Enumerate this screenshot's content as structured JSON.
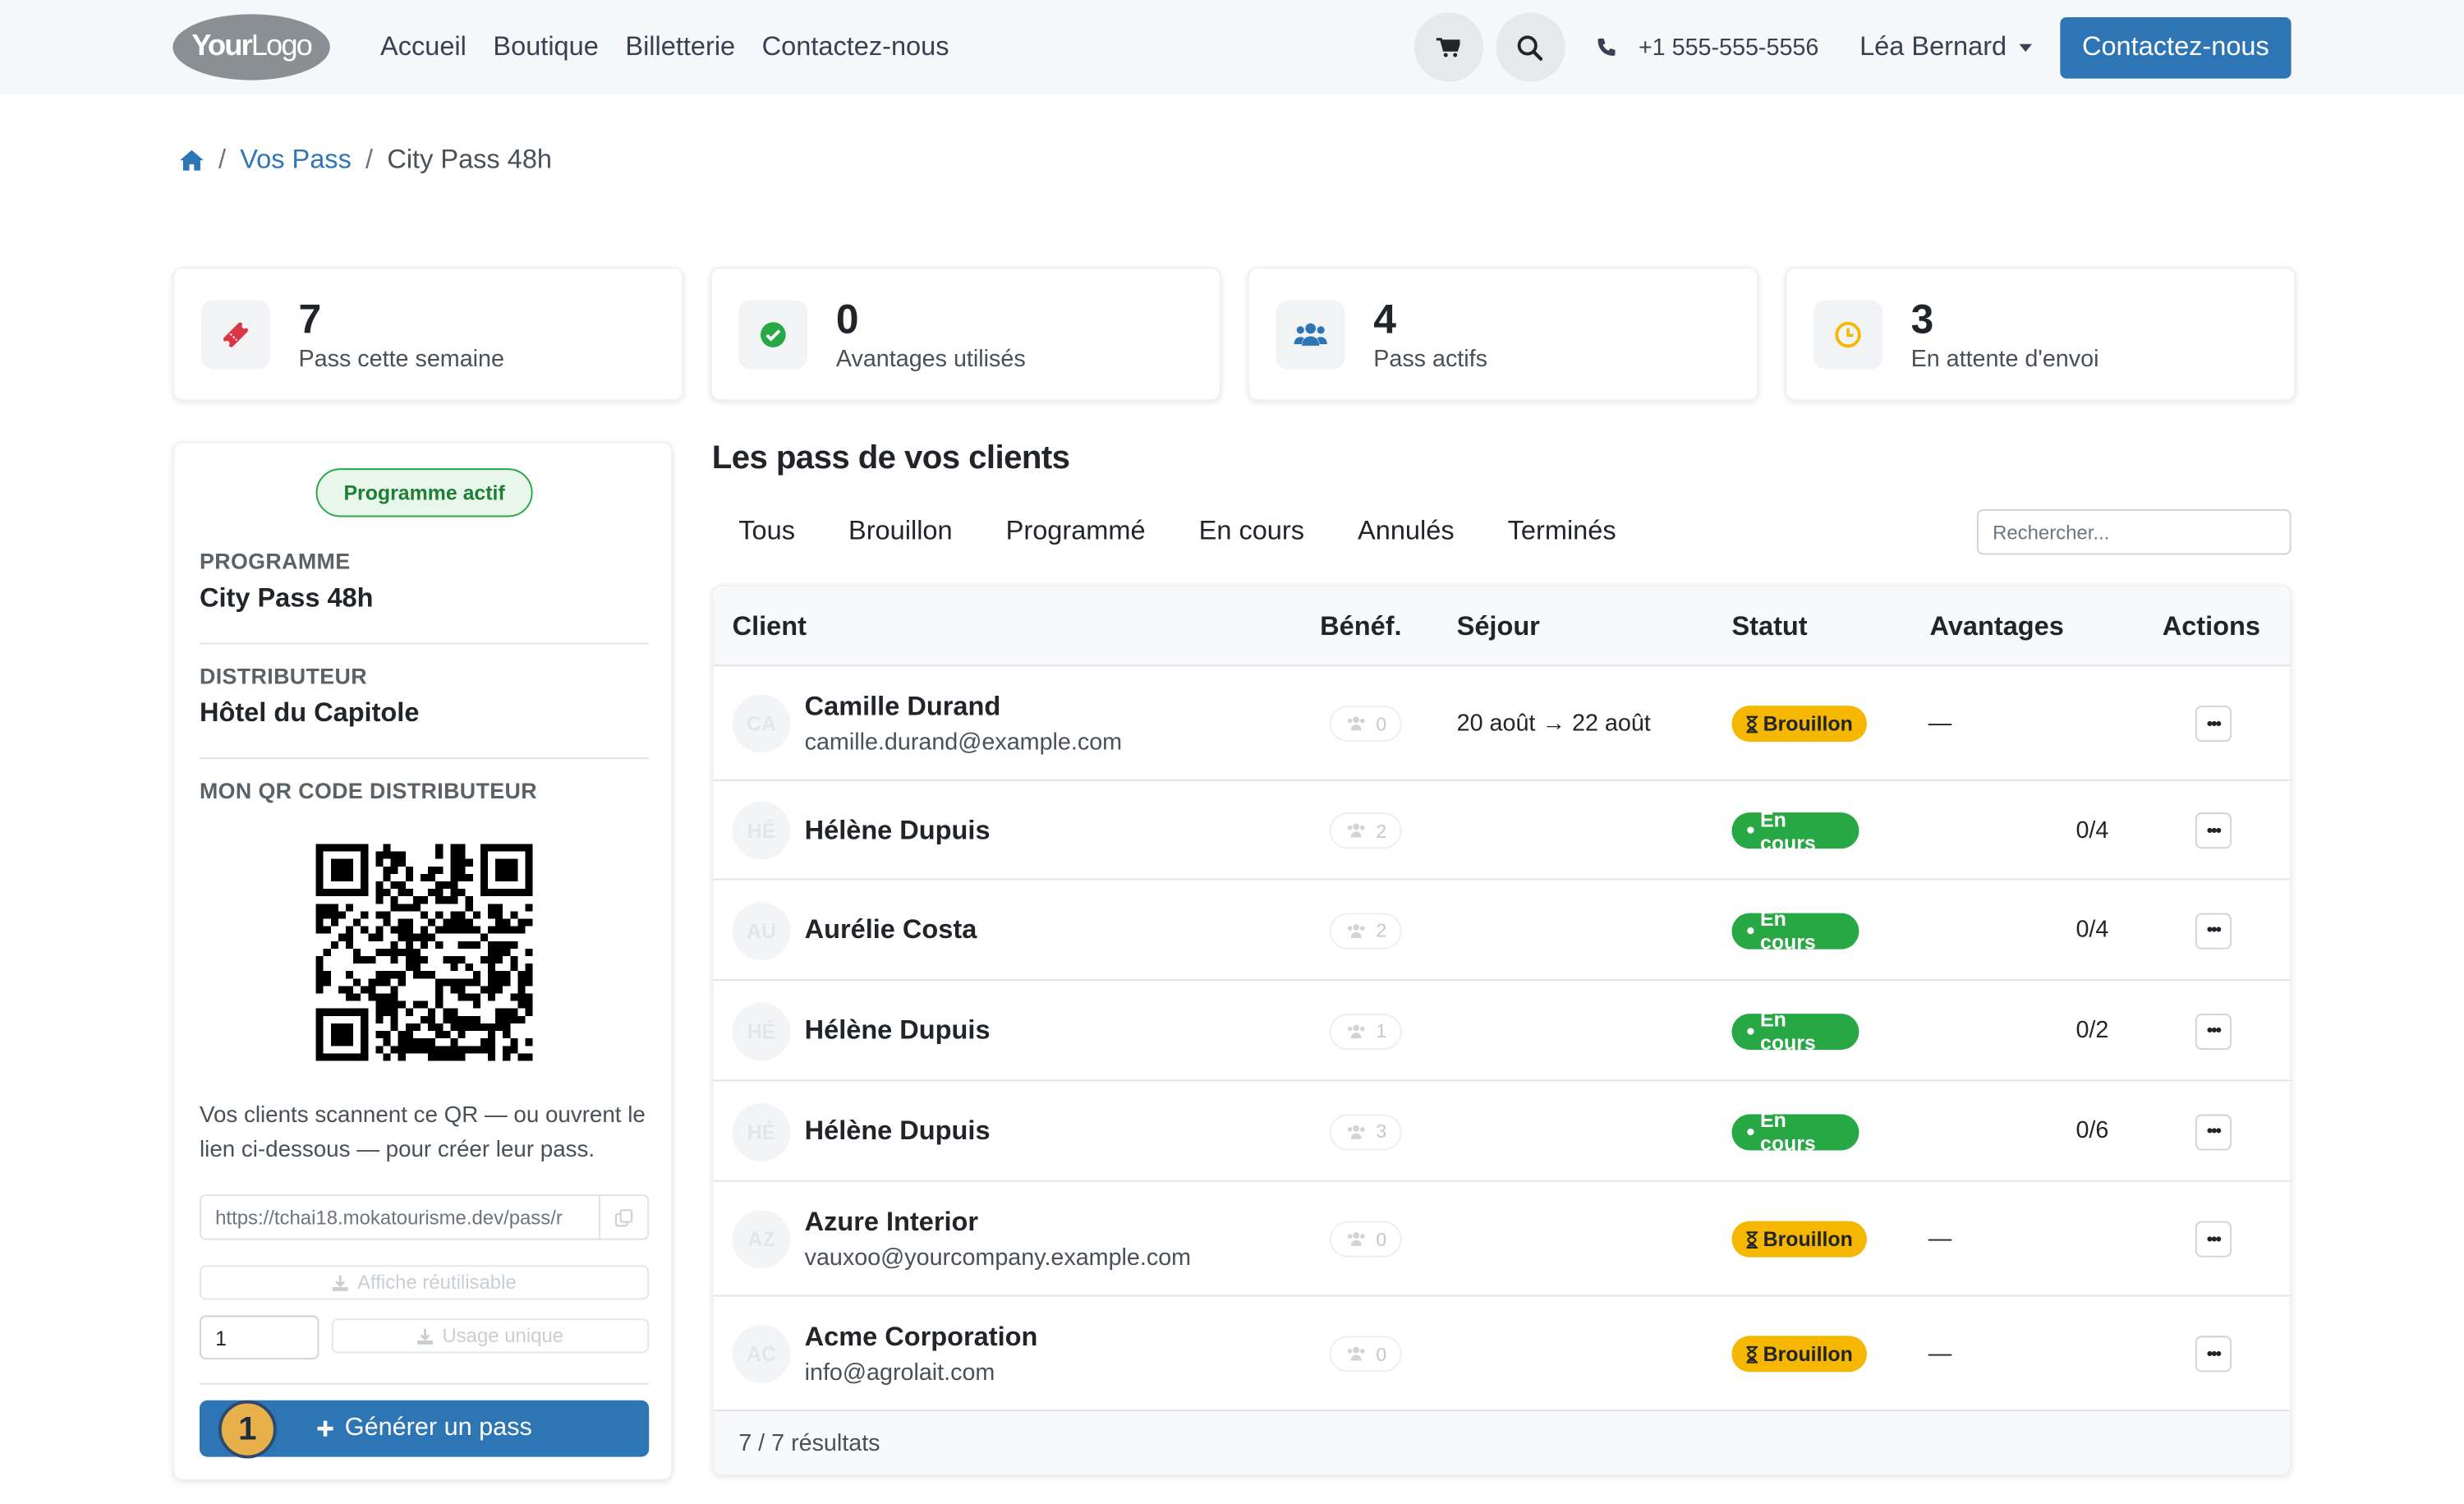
{
  "nav": {
    "logo": {
      "bold": "Your",
      "regular": "Logo"
    },
    "links": [
      "Accueil",
      "Boutique",
      "Billetterie",
      "Contactez-nous"
    ],
    "phone": "+1 555-555-5556",
    "user": "Léa Bernard",
    "cta": "Contactez-nous"
  },
  "breadcrumb": {
    "home_icon": "home-icon",
    "sep": "/",
    "pass": "Vos Pass",
    "current": "City Pass 48h"
  },
  "stats": [
    {
      "value": "7",
      "label": "Pass cette semaine",
      "icon": "ticket-icon",
      "color": "#dc3545"
    },
    {
      "value": "0",
      "label": "Avantages utilisés",
      "icon": "check-circle-icon",
      "color": "#28a745"
    },
    {
      "value": "4",
      "label": "Pass actifs",
      "icon": "users-icon",
      "color": "#2e75b6"
    },
    {
      "value": "3",
      "label": "En attente d'envoi",
      "icon": "clock-icon",
      "color": "#f5b700"
    }
  ],
  "left": {
    "status_badge": "Programme actif",
    "program_label": "PROGRAMME",
    "program_value": "City Pass 48h",
    "distributor_label": "DISTRIBUTEUR",
    "distributor_value": "Hôtel du Capitole",
    "qr_label": "MON QR CODE DISTRIBUTEUR",
    "qr_help": "Vos clients scannent ce QR — ou ouvrent le lien ci-dessous — pour créer leur pass.",
    "url": "https://tchai18.mokatourisme.dev/pass/r",
    "reusable_btn": "Affiche réutilisable",
    "quantity": "1",
    "single_use_btn": "Usage unique",
    "generate_btn": "Générer un pass",
    "step_number": "1"
  },
  "main": {
    "title": "Les pass de vos clients",
    "tabs": [
      "Tous",
      "Brouillon",
      "Programmé",
      "En cours",
      "Annulés",
      "Terminés"
    ],
    "search_placeholder": "Rechercher...",
    "columns": {
      "client": "Client",
      "benef": "Bénéf.",
      "sejour": "Séjour",
      "statut": "Statut",
      "avantages": "Avantages",
      "actions": "Actions"
    },
    "rows": [
      {
        "initials": "CA",
        "name": "Camille Durand",
        "email": "camille.durand@example.com",
        "benef": "0",
        "sejour": "20 août → 22 août",
        "status": "Brouillon",
        "status_type": "draft",
        "avantages": "—"
      },
      {
        "initials": "HÉ",
        "name": "Hélène Dupuis",
        "email": "",
        "benef": "2",
        "sejour": "",
        "status": "En cours",
        "status_type": "run",
        "avantages": "0/4"
      },
      {
        "initials": "AU",
        "name": "Aurélie Costa",
        "email": "",
        "benef": "2",
        "sejour": "",
        "status": "En cours",
        "status_type": "run",
        "avantages": "0/4"
      },
      {
        "initials": "HÉ",
        "name": "Hélène Dupuis",
        "email": "",
        "benef": "1",
        "sejour": "",
        "status": "En cours",
        "status_type": "run",
        "avantages": "0/2"
      },
      {
        "initials": "HÉ",
        "name": "Hélène Dupuis",
        "email": "",
        "benef": "3",
        "sejour": "",
        "status": "En cours",
        "status_type": "run",
        "avantages": "0/6"
      },
      {
        "initials": "AZ",
        "name": "Azure Interior",
        "email": "vauxoo@yourcompany.example.com",
        "benef": "0",
        "sejour": "",
        "status": "Brouillon",
        "status_type": "draft",
        "avantages": "—"
      },
      {
        "initials": "AC",
        "name": "Acme Corporation",
        "email": "info@agrolait.com",
        "benef": "0",
        "sejour": "",
        "status": "Brouillon",
        "status_type": "draft",
        "avantages": "—"
      }
    ],
    "footer": "7 / 7 résultats"
  }
}
